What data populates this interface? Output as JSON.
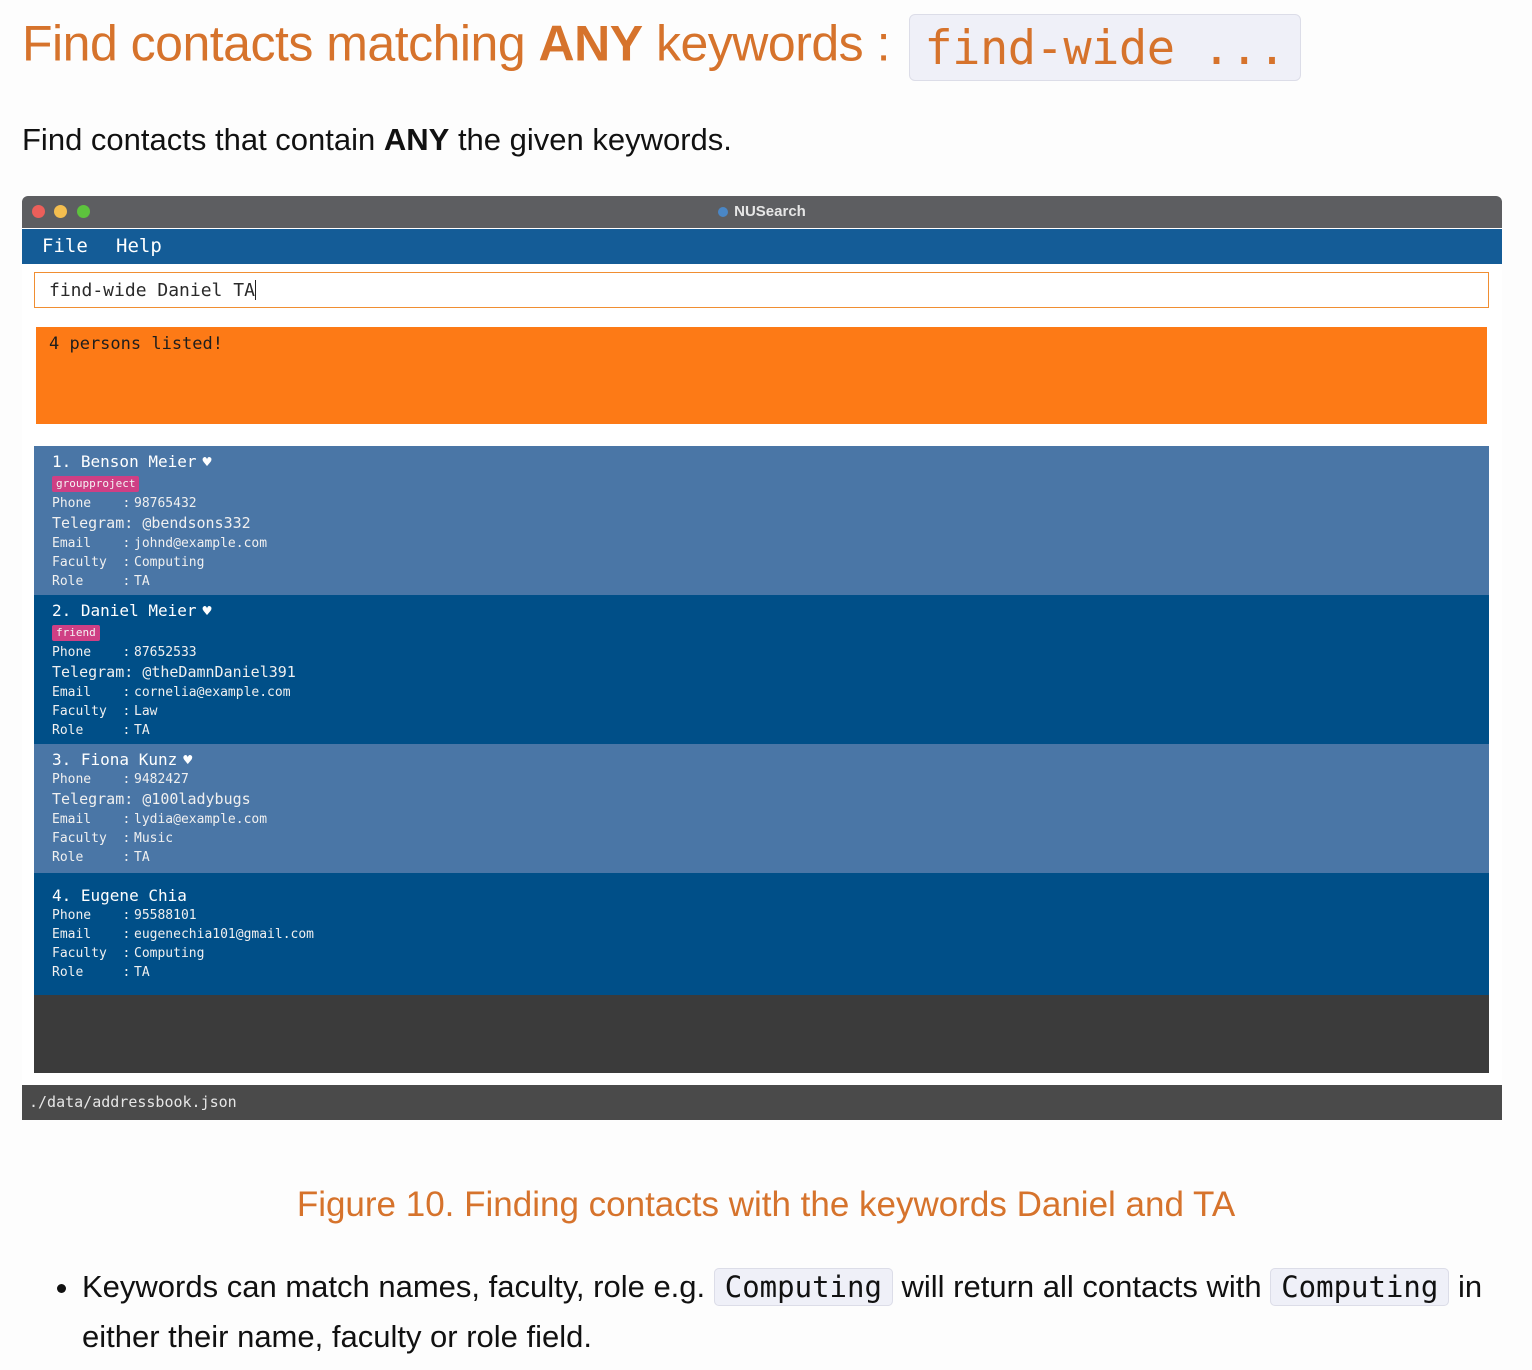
{
  "heading": {
    "text_before": "Find contacts matching ",
    "text_bold": "ANY",
    "text_after": " keywords : ",
    "code": "find-wide ..."
  },
  "intro": {
    "before": "Find contacts that contain ",
    "bold": "ANY",
    "after": " the given keywords."
  },
  "window": {
    "title": "NUSearch",
    "menu": {
      "file": "File",
      "help": "Help"
    },
    "command_input": "find-wide Daniel TA",
    "result_message": "4 persons listed!",
    "status_path": "./data/addressbook.json",
    "labels": {
      "phone": "Phone    : ",
      "telegram": "Telegram: ",
      "email": "Email    : ",
      "faculty": "Faculty  : ",
      "role": "Role     : "
    },
    "persons": [
      {
        "name": "1. Benson Meier",
        "favourite": "♥",
        "tag": "groupproject",
        "phone": "98765432",
        "telegram": "@bendsons332",
        "email": "johnd@example.com",
        "faculty": "Computing",
        "role": "TA"
      },
      {
        "name": "2. Daniel Meier",
        "favourite": "♥",
        "tag": "friend",
        "phone": "87652533",
        "telegram": "@theDamnDaniel391",
        "email": "cornelia@example.com",
        "faculty": "Law",
        "role": "TA"
      },
      {
        "name": "3. Fiona Kunz",
        "favourite": "♥",
        "phone": "9482427",
        "telegram": "@100ladybugs",
        "email": "lydia@example.com",
        "faculty": "Music",
        "role": "TA"
      },
      {
        "name": "4. Eugene Chia",
        "phone": "95588101",
        "email": "eugenechia101@gmail.com",
        "faculty": "Computing",
        "role": "TA"
      }
    ],
    "colors": {
      "menubar": "#145c97",
      "result": "#fd7a16",
      "card_light": "#4a76a6",
      "card_dark": "#004f88",
      "tag": "#cf3f84"
    }
  },
  "caption": "Figure 10. Finding contacts with the keywords Daniel and TA",
  "bullet": {
    "part1": "Keywords can match names, faculty, role e.g. ",
    "code1": "Computing",
    "part2": " will return all contacts with ",
    "code2": "Computing",
    "part3": " in either their name, faculty or role field."
  }
}
